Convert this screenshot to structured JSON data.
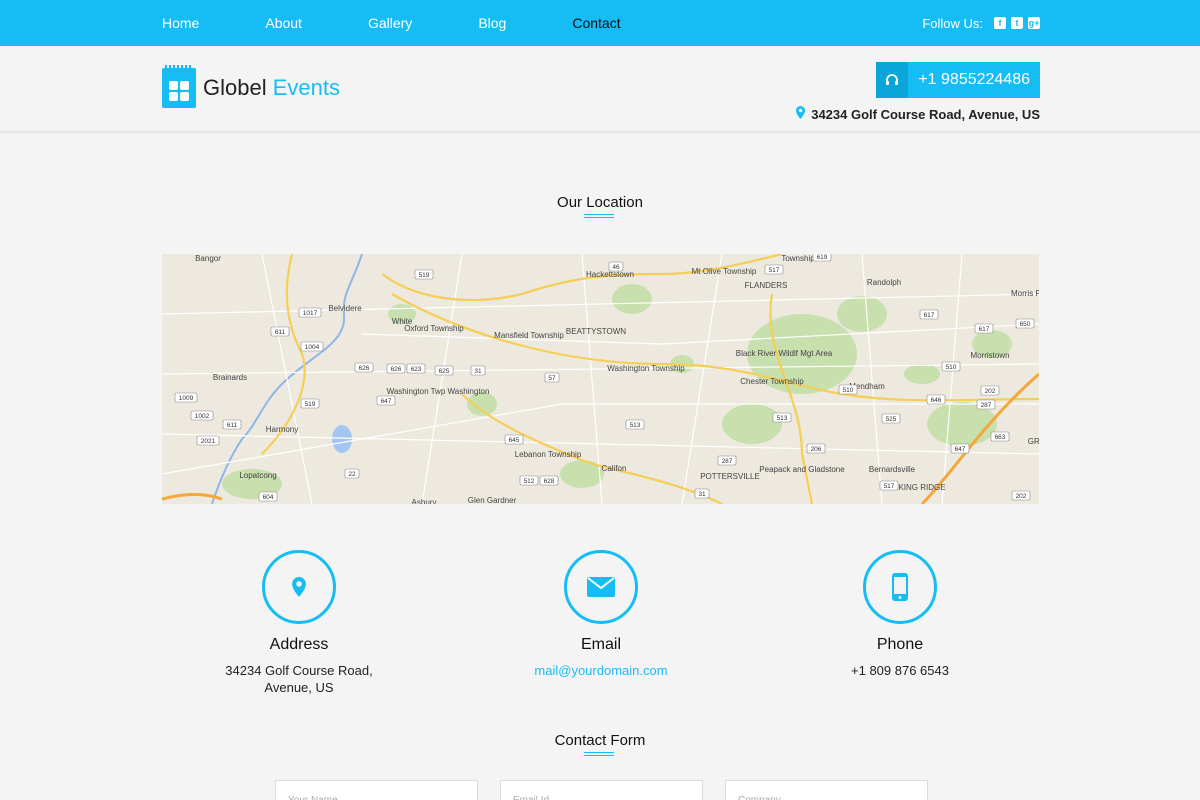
{
  "nav": {
    "items": [
      {
        "label": "Home",
        "active": false
      },
      {
        "label": "About",
        "active": false
      },
      {
        "label": "Gallery",
        "active": false
      },
      {
        "label": "Blog",
        "active": false
      },
      {
        "label": "Contact",
        "active": true
      }
    ],
    "follow_label": "Follow Us:",
    "social": [
      {
        "icon": "facebook-icon",
        "glyph": "f"
      },
      {
        "icon": "twitter-icon",
        "glyph": "t"
      },
      {
        "icon": "google-plus-icon",
        "glyph": "g+"
      }
    ]
  },
  "header": {
    "brand_primary": "Globel",
    "brand_accent": "Events",
    "phone": "+1 9855224486",
    "address": "34234 Golf Course Road, Avenue, US"
  },
  "location": {
    "title": "Our Location",
    "map_labels": [
      "Bangor",
      "Hackettstown",
      "Mt Olive Township",
      "Township",
      "Randolph",
      "Morris Pla",
      "Belvidere",
      "White",
      "Oxford Township",
      "Mansfield Township",
      "BEATTYSTOWN",
      "FLANDERS",
      "Black River Wildlf Mgt Area",
      "Morristown",
      "Brainards",
      "Washington Township",
      "Chester Township",
      "Mendham",
      "Washington Twp Washington",
      "Harmony",
      "Lebanon Township",
      "Califon",
      "Peapack and Gladstone",
      "Bernardsville",
      "Lopatcong",
      "POTTERSVILLE",
      "BASKING RIDGE",
      "Asbury",
      "Glen Gardner",
      "GREEN"
    ],
    "map_shields": [
      "519",
      "46",
      "517",
      "619",
      "1017",
      "611",
      "1004",
      "626",
      "626",
      "623",
      "625",
      "31",
      "57",
      "513",
      "617",
      "617",
      "650",
      "510",
      "510",
      "202",
      "287",
      "647",
      "646",
      "1009",
      "1002",
      "519",
      "525",
      "2021",
      "611",
      "645",
      "513",
      "206",
      "647",
      "663",
      "287",
      "512",
      "628",
      "31",
      "517",
      "202",
      "604",
      "22",
      "57"
    ]
  },
  "contact": {
    "cards": [
      {
        "title": "Address",
        "value_line1": "34234 Golf Course Road,",
        "value_line2": "Avenue, US",
        "icon": "location-pin-icon"
      },
      {
        "title": "Email",
        "value_line1": "mail@yourdomain.com",
        "icon": "envelope-icon"
      },
      {
        "title": "Phone",
        "value_line1": "+1 809 876 6543",
        "icon": "mobile-phone-icon"
      }
    ]
  },
  "form": {
    "title": "Contact Form",
    "fields": [
      {
        "placeholder": "Your Name"
      },
      {
        "placeholder": "Email Id"
      },
      {
        "placeholder": "Company"
      }
    ]
  },
  "colors": {
    "accent": "#16bdf5",
    "accent_dark": "#0aa6da",
    "background": "#f4f4f4"
  }
}
